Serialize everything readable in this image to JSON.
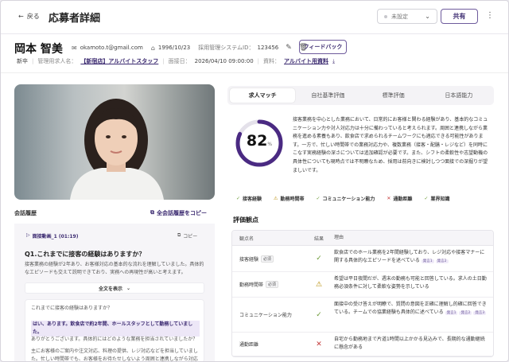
{
  "header": {
    "back_label": "戻る",
    "title": "応募者詳細",
    "status_value": "未設定",
    "share_label": "共有"
  },
  "profile": {
    "name": "岡本 智美",
    "email": "okamoto.t@gmail.com",
    "birthdate": "1996/10/23",
    "system_id_label": "採用管理システムID：",
    "system_id": "123456",
    "feedback_label": "フィードバック",
    "type_badge": "新卒",
    "job_label": "管理用求人名：",
    "job_name": "【新宿店】アルバイトスタッフ",
    "interview_label": "面接日：",
    "interview_date": "2026/04/10 09:00:00",
    "material_label": "資料：",
    "material_name": "アルバイト用資料"
  },
  "history": {
    "heading": "会話履歴",
    "copy_all": "全会話履歴をコピー",
    "media_label": "面接動画_1 (01:19)",
    "copy": "コピー",
    "question": "Q1.これまでに接客の経験はありますか？",
    "summary": "接客業務の経験が2年あり、お客様対応の基本的な流れを理解していました。具体的なエピソードも交えて説明できており、実務への再現性が高いと考えます。",
    "expand_label": "全文を表示",
    "transcript": [
      "これまでに接客の経験はありますか？",
      "はい、あります。飲食店で約2年間、ホールスタッフとして勤務していました。",
      "ありがとうございます。具体的にはどのような業務を担当されていましたか？",
      "主にお客様のご案内や注文対応、料理の提供、レジ対応などを担当していました。忙しい時間帯でも、お客様をお待たせしないよう周囲と連携しながら対応することを意識していました。"
    ]
  },
  "tabs": [
    "求人マッチ",
    "自社基準評価",
    "標準評価",
    "日本語能力"
  ],
  "match": {
    "score": 82,
    "score_unit": "%",
    "summary": "接客業務を中心とした業務において、日常的にお客様と関わる経験があり、基本的なコミュニケーション力や対人対応力は十分に備わっていると考えられます。周囲と連携しながら業務を進める素養もあり、飲食店で求められるチームワークにも適応できる可能性があります。一方で、忙しい時間帯での業務対応力や、複数業務（接客・配膳・レジなど）を同時にこなす実務経験の深さについては追加確認が必要です。また、シフトの柔軟性や志望動機の具体性についても現時点では不明瞭なため、採用は前向きに検討しつつ面接での深掘りが望ましいです。",
    "chips": [
      {
        "label": "接客経験",
        "status": "ok"
      },
      {
        "label": "勤務時間帯",
        "status": "warn"
      },
      {
        "label": "コミュニケーション能力",
        "status": "ok"
      },
      {
        "label": "通勤距離",
        "status": "ng"
      },
      {
        "label": "業界知識",
        "status": "ok"
      }
    ]
  },
  "evaluation": {
    "heading": "評価観点",
    "columns": [
      "観点名",
      "結果",
      "理由"
    ],
    "required_label": "必須",
    "rows": [
      {
        "name": "接客経験",
        "required": true,
        "result": "ok",
        "reason": "飲食店でのホール業務を2年間経験しており、レジ対応や接客マナーに関する具体的なエピソードを述べている",
        "refs": [
          "発言1",
          "発言2"
        ]
      },
      {
        "name": "勤務時間帯",
        "required": true,
        "result": "warn",
        "reason": "希望は平日夜間だが、週末の勤務も可能と回答している。求人の土日勤務必須条件に対して柔軟な姿勢を示している",
        "refs": []
      },
      {
        "name": "コミュニケーション能力",
        "required": false,
        "result": "ok",
        "reason": "面接中の受け答えが明瞭で、質問の意図を正確に理解し的確に回答できている。チームでの協業経験も具体的に述べている",
        "refs": [
          "発言1",
          "発言2",
          "発言3"
        ]
      },
      {
        "name": "通勤距離",
        "required": false,
        "result": "ng",
        "reason": "自宅から勤務地まで片道1時間以上かかる見込みで、長期的な通勤継続に懸念がある",
        "refs": []
      }
    ]
  },
  "colors": {
    "accent": "#3b2a70",
    "ring": "#4a2a82",
    "ok": "#6b9a36",
    "warn": "#b58a00",
    "ng": "#c43a3a"
  }
}
